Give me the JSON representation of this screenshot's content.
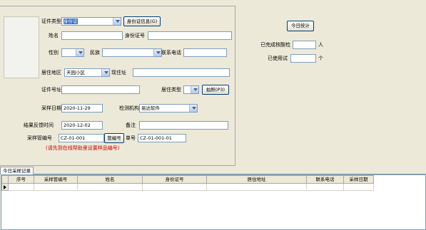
{
  "form": {
    "id_type": {
      "label": "证件类型",
      "value": "身份证"
    },
    "read_id_button": "身份证信息(G)",
    "name": {
      "label": "姓名",
      "value": ""
    },
    "id_number": {
      "label": "身份证号",
      "value": ""
    },
    "gender": {
      "label": "性别",
      "value": ""
    },
    "ethnicity": {
      "label": "民族",
      "value": ""
    },
    "phone": {
      "label": "联系电话",
      "value": ""
    },
    "residence_area": {
      "label": "居住地区",
      "value": "天园小区"
    },
    "current_address": {
      "label": "现住址",
      "value": ""
    },
    "id_address": {
      "label": "证件号址",
      "value": ""
    },
    "residence_type": {
      "label": "居住类型",
      "value": ""
    },
    "photo_button": "拍照(P3)",
    "sample_date": {
      "label": "采样日期",
      "value": "2020-11-29"
    },
    "test_agency": {
      "label": "检测机构",
      "value": "易达软件"
    },
    "result_date": {
      "label": "结果反馈时间",
      "value": "2020-12-02"
    },
    "remark": {
      "label": "备注",
      "value": ""
    },
    "tube_number": {
      "label": "采样管编号",
      "value": "CZ-01-001"
    },
    "tube_button": "管编号",
    "single_number": {
      "label": "单号",
      "value": "CZ-01-001-01"
    },
    "hint": "(请先到在线帮助里设置样品编号)"
  },
  "stats": {
    "today_button": "今日统计",
    "completed_label": "已完成核酸检",
    "completed_unit": "人",
    "used_tubes_label": "已使用试",
    "used_tubes_unit": "个"
  },
  "tab": {
    "label": "今日采样记录"
  },
  "grid": {
    "columns": [
      "序号",
      "采样管编号",
      "姓名",
      "身份证号",
      "居住地址",
      "联系电话",
      "采样日期"
    ],
    "rows": [
      [
        "",
        "",
        "",
        "",
        "",
        "",
        ""
      ]
    ]
  },
  "colors": {
    "hint": "#cc0000",
    "selection": "#316ac5",
    "window_bg": "#ece9d8"
  },
  "icons": {
    "dropdown": "chevron-down-icon",
    "current_row": "row-pointer-icon"
  }
}
